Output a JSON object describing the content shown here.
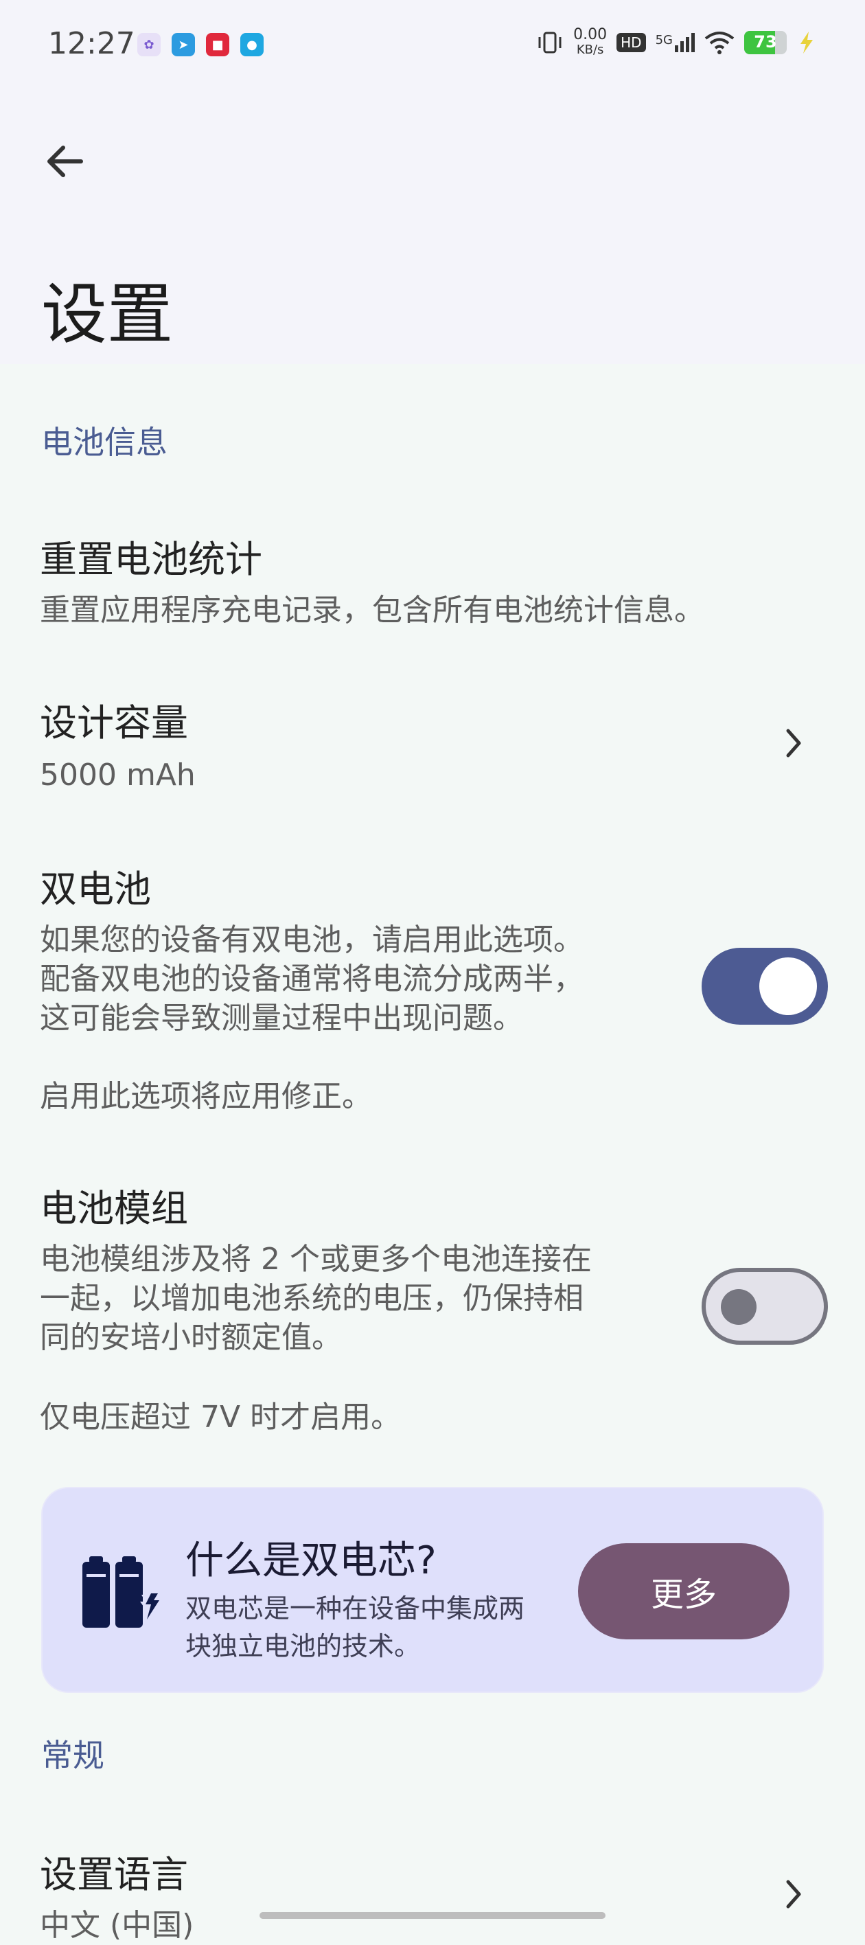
{
  "status_bar": {
    "time": "12:27",
    "net_speed_value": "0.00",
    "net_speed_unit": "KB/s",
    "hd_label": "HD",
    "network_label": "5G",
    "battery_level": "73",
    "battery_fraction": 0.73
  },
  "header": {
    "title": "设置"
  },
  "battery_section": {
    "header": "电池信息",
    "reset": {
      "title": "重置电池统计",
      "subtitle": "重置应用程序充电记录，包含所有电池统计信息。"
    },
    "capacity": {
      "title": "设计容量",
      "value": "5000 mAh"
    },
    "dual_battery": {
      "title": "双电池",
      "line1": "如果您的设备有双电池，请启用此选项。",
      "line2": "配备双电池的设备通常将电流分成两半，",
      "line3": "这可能会导致测量过程中出现问题。",
      "note": "启用此选项将应用修正。",
      "enabled": true
    },
    "battery_pack": {
      "title": "电池模组",
      "line1": "电池模组涉及将 2 个或更多个电池连接在",
      "line2": "一起，以增加电池系统的电压，仍保持相",
      "line3": "同的安培小时额定值。",
      "note": "仅电压超过 7V 时才启用。",
      "enabled": false
    },
    "info_card": {
      "title": "什么是双电芯?",
      "line1": "双电芯是一种在设备中集成两",
      "line2": "块独立电池的技术。",
      "button": "更多"
    }
  },
  "general_section": {
    "header": "常规",
    "language": {
      "title": "设置语言",
      "value": "中文 (中国)"
    }
  },
  "colors": {
    "accent": "#4d5b93",
    "card_bg": "#dfe0fb",
    "button_bg": "#765672",
    "battery_green": "#3ec440"
  }
}
